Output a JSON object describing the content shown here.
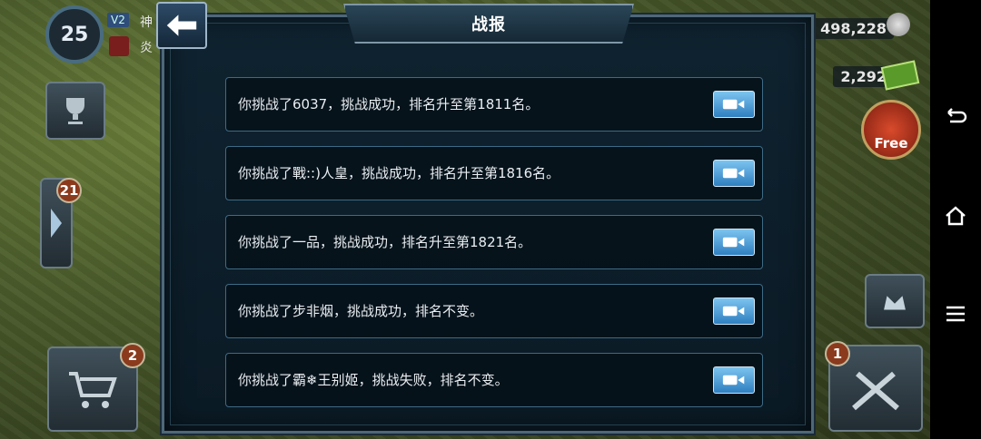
{
  "hud": {
    "level": "25",
    "vip": "V2",
    "name": "神",
    "clan": "炎",
    "silver": "498,228",
    "cash": "2,292",
    "gift_label": "Free",
    "mission_badge": "21",
    "cart_badge": "2",
    "battle_badge": "1"
  },
  "dialog": {
    "title": "战报",
    "rows": [
      {
        "text": "你挑战了6037，挑战成功，排名升至第1811名。"
      },
      {
        "text": "你挑战了戰::)人皇，挑战成功，排名升至第1816名。"
      },
      {
        "text": "你挑战了一品，挑战成功，排名升至第1821名。"
      },
      {
        "text": "你挑战了步非烟，挑战成功，排名不变。"
      },
      {
        "text": "你挑战了霸❄王别姬，挑战失败，排名不变。"
      }
    ]
  },
  "colors": {
    "accent": "#3e6a85",
    "replay": "#2f7fc0"
  }
}
